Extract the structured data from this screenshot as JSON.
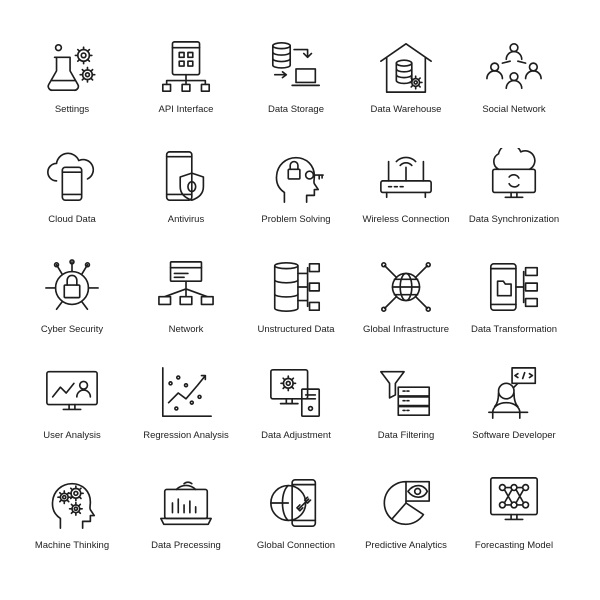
{
  "icons": [
    {
      "label": "Settings",
      "icon": "flask-gears-icon"
    },
    {
      "label": "API Interface",
      "icon": "api-tree-icon"
    },
    {
      "label": "Data Storage",
      "icon": "database-laptop-icon"
    },
    {
      "label": "Data Warehouse",
      "icon": "warehouse-icon"
    },
    {
      "label": "Social Network",
      "icon": "people-network-icon"
    },
    {
      "label": "Cloud Data",
      "icon": "cloud-phone-icon"
    },
    {
      "label": "Antivirus",
      "icon": "phone-shield-bug-icon"
    },
    {
      "label": "Problem Solving",
      "icon": "head-lock-key-icon"
    },
    {
      "label": "Wireless Connection",
      "icon": "router-icon"
    },
    {
      "label": "Data Synchronization",
      "icon": "cloud-monitor-sync-icon"
    },
    {
      "label": "Cyber Security",
      "icon": "lock-circuit-icon"
    },
    {
      "label": "Network",
      "icon": "server-network-icon"
    },
    {
      "label": "Unstructured Data",
      "icon": "database-branches-icon"
    },
    {
      "label": "Global Infrastructure",
      "icon": "globe-nodes-icon"
    },
    {
      "label": "Data Transformation",
      "icon": "phone-folder-icon"
    },
    {
      "label": "User Analysis",
      "icon": "monitor-chart-user-icon"
    },
    {
      "label": "Regression Analysis",
      "icon": "scatter-chart-icon"
    },
    {
      "label": "Data Adjustment",
      "icon": "computer-gear-icon"
    },
    {
      "label": "Data Filtering",
      "icon": "funnel-servers-icon"
    },
    {
      "label": "Software Developer",
      "icon": "developer-icon"
    },
    {
      "label": "Machine Thinking",
      "icon": "head-gears-icon"
    },
    {
      "label": "Data Precessing",
      "icon": "laptop-gear-icon"
    },
    {
      "label": "Global Connection",
      "icon": "phone-globe-link-icon"
    },
    {
      "label": "Predictive Analytics",
      "icon": "pie-eye-icon"
    },
    {
      "label": "Forecasting Model",
      "icon": "monitor-network-icon"
    }
  ]
}
